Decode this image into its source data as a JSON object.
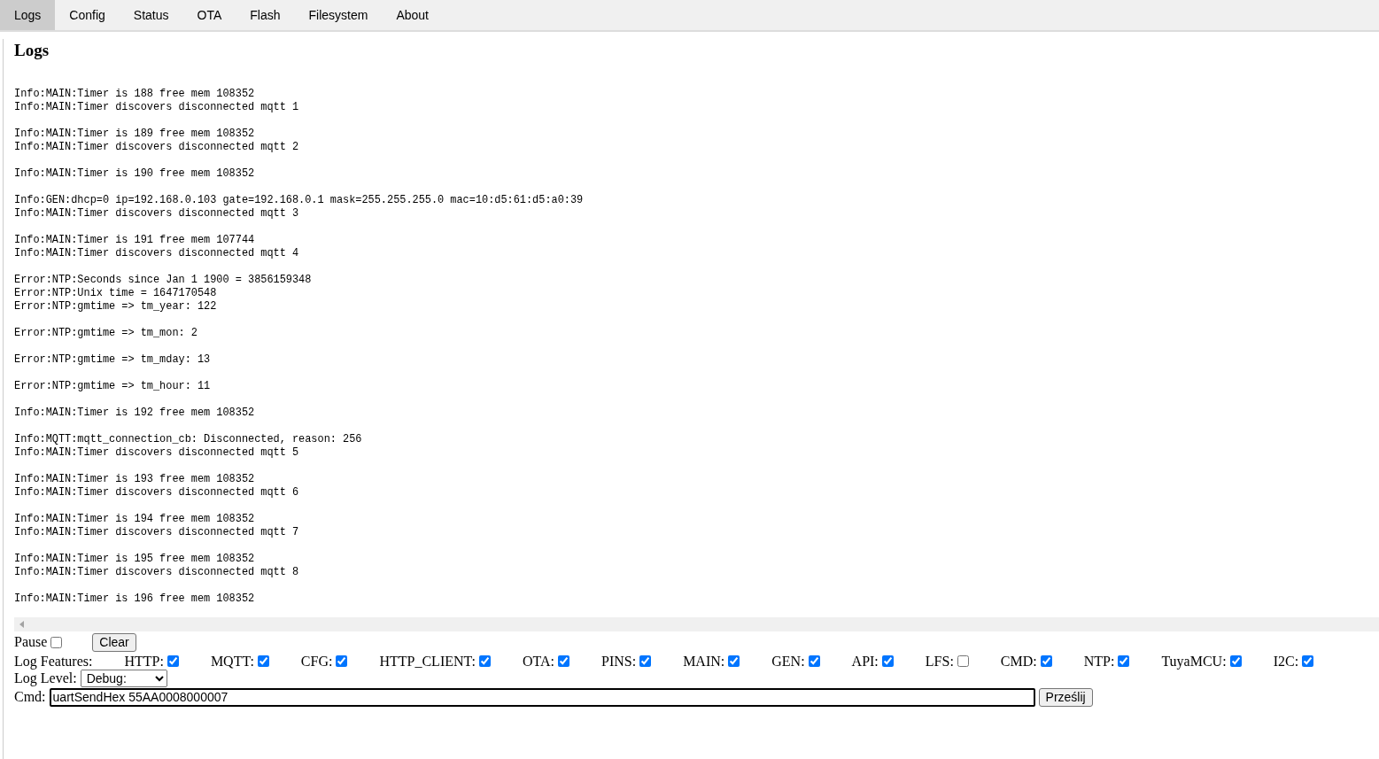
{
  "tabs": [
    {
      "label": "Logs",
      "selected": true
    },
    {
      "label": "Config",
      "selected": false
    },
    {
      "label": "Status",
      "selected": false
    },
    {
      "label": "OTA",
      "selected": false
    },
    {
      "label": "Flash",
      "selected": false
    },
    {
      "label": "Filesystem",
      "selected": false
    },
    {
      "label": "About",
      "selected": false
    }
  ],
  "heading": "Logs",
  "log_blocks": [
    [
      "Info:MAIN:Timer is 188 free mem 108352",
      "Info:MAIN:Timer discovers disconnected mqtt 1"
    ],
    [
      "Info:MAIN:Timer is 189 free mem 108352",
      "Info:MAIN:Timer discovers disconnected mqtt 2"
    ],
    [
      "Info:MAIN:Timer is 190 free mem 108352"
    ],
    [
      "Info:GEN:dhcp=0 ip=192.168.0.103 gate=192.168.0.1 mask=255.255.255.0 mac=10:d5:61:d5:a0:39",
      "Info:MAIN:Timer discovers disconnected mqtt 3"
    ],
    [
      "Info:MAIN:Timer is 191 free mem 107744",
      "Info:MAIN:Timer discovers disconnected mqtt 4"
    ],
    [
      "Error:NTP:Seconds since Jan 1 1900 = 3856159348",
      "Error:NTP:Unix time = 1647170548",
      "Error:NTP:gmtime => tm_year: 122"
    ],
    [
      "Error:NTP:gmtime => tm_mon: 2"
    ],
    [
      "Error:NTP:gmtime => tm_mday: 13"
    ],
    [
      "Error:NTP:gmtime => tm_hour: 11"
    ],
    [
      "Info:MAIN:Timer is 192 free mem 108352"
    ],
    [
      "Info:MQTT:mqtt_connection_cb: Disconnected, reason: 256",
      "Info:MAIN:Timer discovers disconnected mqtt 5"
    ],
    [
      "Info:MAIN:Timer is 193 free mem 108352",
      "Info:MAIN:Timer discovers disconnected mqtt 6"
    ],
    [
      "Info:MAIN:Timer is 194 free mem 108352",
      "Info:MAIN:Timer discovers disconnected mqtt 7"
    ],
    [
      "Info:MAIN:Timer is 195 free mem 108352",
      "Info:MAIN:Timer discovers disconnected mqtt 8"
    ],
    [
      "Info:MAIN:Timer is 196 free mem 108352"
    ]
  ],
  "pause": {
    "label": "Pause",
    "checked": false
  },
  "clear_button": "Clear",
  "log_features": {
    "label": "Log Features:",
    "items": [
      {
        "label": "HTTP:",
        "checked": true
      },
      {
        "label": "MQTT:",
        "checked": true
      },
      {
        "label": "CFG:",
        "checked": true
      },
      {
        "label": "HTTP_CLIENT:",
        "checked": true
      },
      {
        "label": "OTA:",
        "checked": true
      },
      {
        "label": "PINS:",
        "checked": true
      },
      {
        "label": "MAIN:",
        "checked": true
      },
      {
        "label": "GEN:",
        "checked": true
      },
      {
        "label": "API:",
        "checked": true
      },
      {
        "label": "LFS:",
        "checked": false
      },
      {
        "label": "CMD:",
        "checked": true
      },
      {
        "label": "NTP:",
        "checked": true
      },
      {
        "label": "TuyaMCU:",
        "checked": true
      },
      {
        "label": "I2C:",
        "checked": true
      }
    ]
  },
  "log_level": {
    "label": "Log Level:",
    "value": "Debug:"
  },
  "cmd": {
    "label": "Cmd:",
    "value": "uartSendHex 55AA0008000007",
    "button": "Prześlij"
  }
}
